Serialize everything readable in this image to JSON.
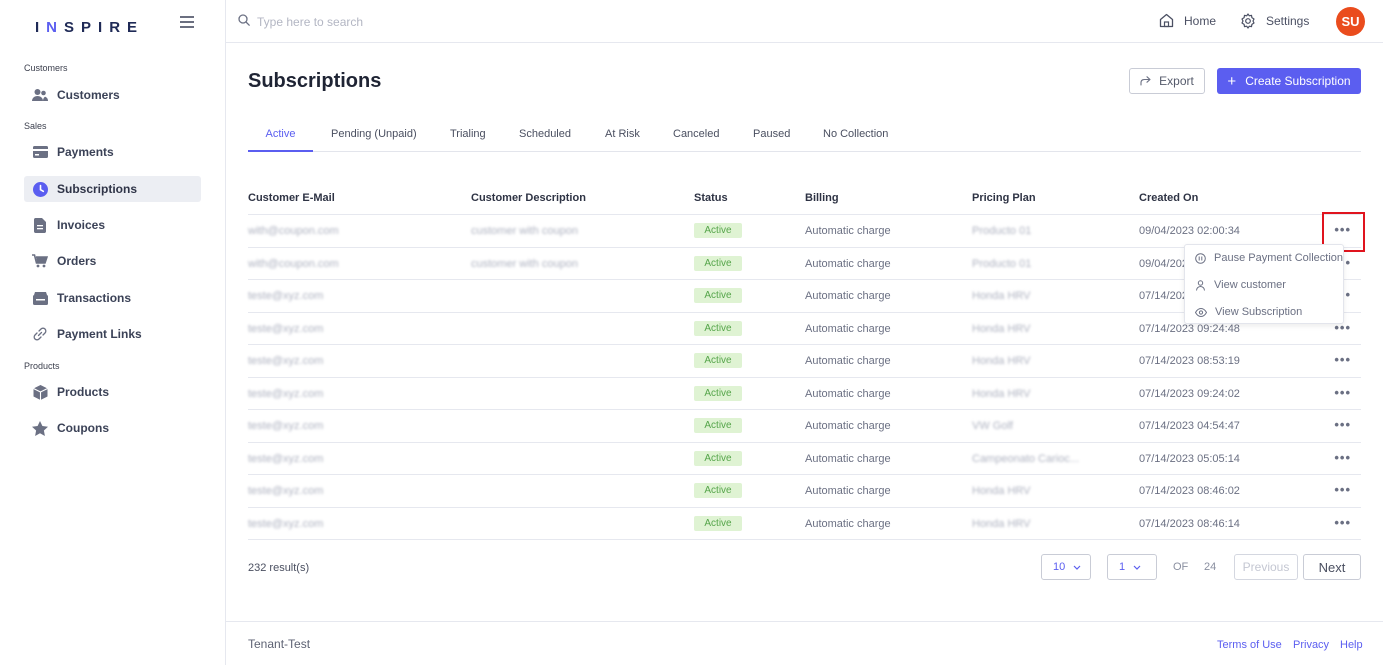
{
  "app": {
    "logo_text": "INSPIRE",
    "accent_color": "#5b5ef0",
    "brand_color": "#1f2a56"
  },
  "sidebar": {
    "sections": [
      {
        "label": "Customers"
      },
      {
        "label": "Sales"
      },
      {
        "label": "Products"
      }
    ],
    "items": [
      {
        "label": "Customers",
        "icon": "users-icon"
      },
      {
        "label": "Payments",
        "icon": "credit-card-icon"
      },
      {
        "label": "Subscriptions",
        "icon": "clock-icon",
        "active": true
      },
      {
        "label": "Invoices",
        "icon": "document-icon"
      },
      {
        "label": "Orders",
        "icon": "cart-icon"
      },
      {
        "label": "Transactions",
        "icon": "wallet-icon"
      },
      {
        "label": "Payment Links",
        "icon": "link-icon"
      },
      {
        "label": "Products",
        "icon": "box-icon"
      },
      {
        "label": "Coupons",
        "icon": "star-icon"
      }
    ]
  },
  "topbar": {
    "search_placeholder": "Type here to search",
    "home_label": "Home",
    "settings_label": "Settings",
    "avatar_initials": "SU",
    "avatar_color": "#ea4c1d"
  },
  "main": {
    "title": "Subscriptions",
    "export_label": "Export",
    "create_label": "Create Subscription",
    "tabs": [
      {
        "label": "Active",
        "active": true
      },
      {
        "label": "Pending (Unpaid)"
      },
      {
        "label": "Trialing"
      },
      {
        "label": "Scheduled"
      },
      {
        "label": "At Risk"
      },
      {
        "label": "Canceled"
      },
      {
        "label": "Paused"
      },
      {
        "label": "No Collection"
      }
    ]
  },
  "table": {
    "headers": [
      "Customer E-Mail",
      "Customer Description",
      "Status",
      "Billing",
      "Pricing Plan",
      "Created On"
    ],
    "rows": [
      {
        "email": "with@coupon.com",
        "description": "customer with coupon",
        "status": "Active",
        "billing": "Automatic charge",
        "plan": "Producto 01",
        "created": "09/04/2023 02:00:34"
      },
      {
        "email": "with@coupon.com",
        "description": "customer with coupon",
        "status": "Active",
        "billing": "Automatic charge",
        "plan": "Producto 01",
        "created": "09/04/2023 02:00:34"
      },
      {
        "email": "teste@xyz.com",
        "description": "",
        "status": "Active",
        "billing": "Automatic charge",
        "plan": "Honda HRV",
        "created": "07/14/2023 09:24:48"
      },
      {
        "email": "teste@xyz.com",
        "description": "",
        "status": "Active",
        "billing": "Automatic charge",
        "plan": "Honda HRV",
        "created": "07/14/2023 09:24:48"
      },
      {
        "email": "teste@xyz.com",
        "description": "",
        "status": "Active",
        "billing": "Automatic charge",
        "plan": "Honda HRV",
        "created": "07/14/2023 08:53:19"
      },
      {
        "email": "teste@xyz.com",
        "description": "",
        "status": "Active",
        "billing": "Automatic charge",
        "plan": "Honda HRV",
        "created": "07/14/2023 09:24:02"
      },
      {
        "email": "teste@xyz.com",
        "description": "",
        "status": "Active",
        "billing": "Automatic charge",
        "plan": "VW Golf",
        "created": "07/14/2023 04:54:47"
      },
      {
        "email": "teste@xyz.com",
        "description": "",
        "status": "Active",
        "billing": "Automatic charge",
        "plan": "Campeonato Carioc...",
        "created": "07/14/2023 05:05:14"
      },
      {
        "email": "teste@xyz.com",
        "description": "",
        "status": "Active",
        "billing": "Automatic charge",
        "plan": "Honda HRV",
        "created": "07/14/2023 08:46:02"
      },
      {
        "email": "teste@xyz.com",
        "description": "",
        "status": "Active",
        "billing": "Automatic charge",
        "plan": "Honda HRV",
        "created": "07/14/2023 08:46:14"
      }
    ],
    "row_menu": [
      {
        "label": "Pause Payment Collection",
        "icon": "pause-circle-icon"
      },
      {
        "label": "View customer",
        "icon": "person-icon"
      },
      {
        "label": "View Subscription",
        "icon": "eye-icon"
      }
    ],
    "menu_symbol": "•••"
  },
  "pagination": {
    "results_text": "232 result(s)",
    "page_size": "10",
    "current_page": "1",
    "of_label": "OF",
    "total_pages": "24",
    "previous_label": "Previous",
    "next_label": "Next"
  },
  "footer": {
    "tenant": "Tenant-Test",
    "links": [
      "Terms of Use",
      "Privacy",
      "Help"
    ]
  }
}
